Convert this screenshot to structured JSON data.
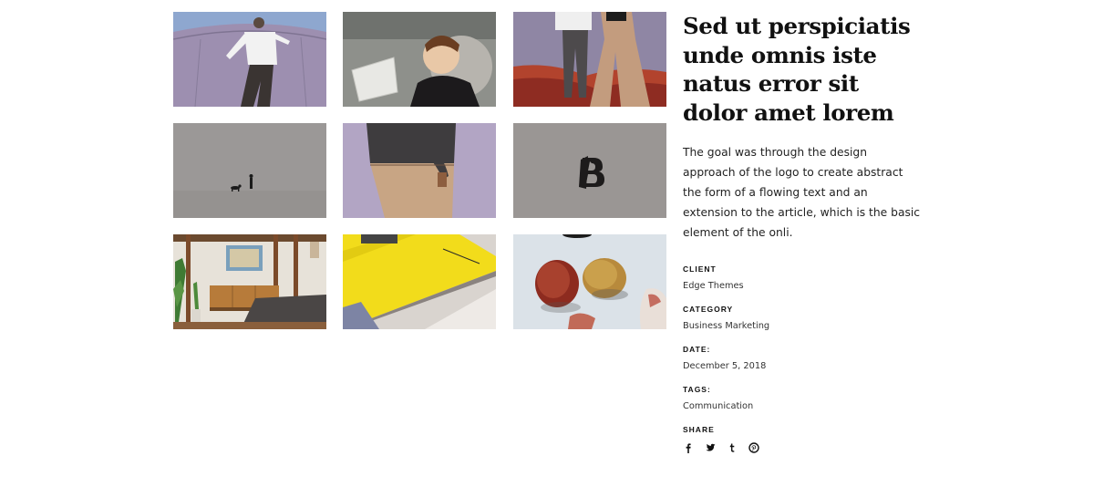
{
  "project": {
    "title": "Sed ut perspiciatis unde omnis iste natus error sit dolor amet lorem",
    "description": "The goal was through the design approach of the logo to create abstract the form of a flowing text and an extension to the article, which is the basic element of the onli."
  },
  "gallery": [
    {
      "icon": "man-on-tank-photo"
    },
    {
      "icon": "child-with-paper-photo"
    },
    {
      "icon": "two-people-legs-photo"
    },
    {
      "icon": "dog-walker-photo"
    },
    {
      "icon": "person-beige-pants-photo"
    },
    {
      "icon": "b-logo-photo"
    },
    {
      "icon": "interior-room-photo"
    },
    {
      "icon": "yellow-magazine-photo"
    },
    {
      "icon": "lychee-fruit-photo"
    }
  ],
  "meta": {
    "client_label": "CLIENT",
    "client_value": "Edge Themes",
    "category_label": "CATEGORY",
    "category_value": "Business Marketing",
    "date_label": "DATE:",
    "date_value": "December 5, 2018",
    "tags_label": "TAGS:",
    "tags_value": "Communication",
    "share_label": "SHARE"
  },
  "share_icons": [
    "facebook-icon",
    "twitter-icon",
    "tumblr-icon",
    "pinterest-icon"
  ],
  "colors": {
    "text": "#111111",
    "tile_grey": "#9a9694",
    "tile_lavender": "#b8a9c9",
    "tile_yellow": "#f2dc1b"
  }
}
